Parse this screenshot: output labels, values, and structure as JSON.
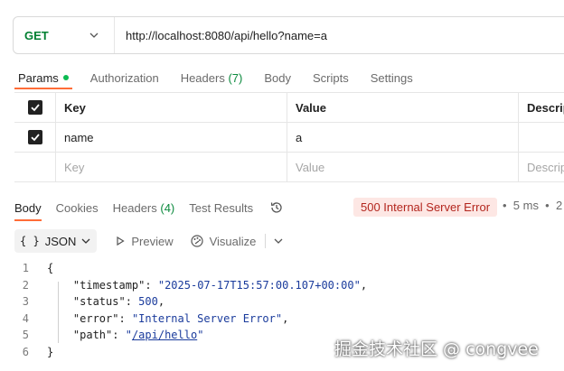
{
  "request": {
    "method": "GET",
    "url": "http://localhost:8080/api/hello?name=a"
  },
  "request_tabs": {
    "params": "Params",
    "authorization": "Authorization",
    "headers": "Headers",
    "headers_count": "(7)",
    "body": "Body",
    "scripts": "Scripts",
    "settings": "Settings"
  },
  "params_table": {
    "headers": {
      "key": "Key",
      "value": "Value",
      "description": "Descrip"
    },
    "rows": [
      {
        "key": "name",
        "value": "a",
        "checked": true
      }
    ],
    "placeholder": {
      "key": "Key",
      "value": "Value",
      "description": "Descrip"
    }
  },
  "response_tabs": {
    "body": "Body",
    "cookies": "Cookies",
    "headers": "Headers",
    "headers_count": "(4)",
    "test_results": "Test Results",
    "status": "500 Internal Server Error",
    "time": "5 ms",
    "size_cut": "2"
  },
  "response_toolbar": {
    "format": "JSON",
    "preview": "Preview",
    "visualize": "Visualize"
  },
  "response_body": {
    "line_numbers": [
      "1",
      "2",
      "3",
      "4",
      "5",
      "6"
    ],
    "open_brace": "{",
    "close_brace": "}",
    "fields": [
      {
        "key": "\"timestamp\"",
        "value": "\"2025-07-17T15:57:00.107+00:00\"",
        "trail": ","
      },
      {
        "key": "\"status\"",
        "value": "500",
        "trail": ","
      },
      {
        "key": "\"error\"",
        "value": "\"Internal Server Error\"",
        "trail": ","
      },
      {
        "key": "\"path\"",
        "value_q1": "\"",
        "value_link": "/api/hello",
        "value_q2": "\"",
        "trail": ""
      }
    ]
  },
  "watermark": "掘金技术社区 @ congvee",
  "colors": {
    "method_green": "#007f31",
    "accent_orange": "#ff6c37",
    "error_bg": "#fde7e4",
    "error_text": "#b3261e",
    "json_value": "#1a3b9c"
  }
}
